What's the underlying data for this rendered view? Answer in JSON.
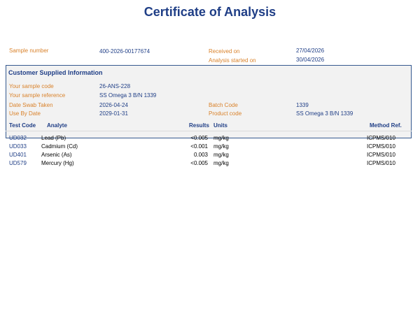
{
  "title": "Certificate of Analysis",
  "sample": {
    "sample_number_label": "Sample number",
    "sample_number": "400-2026-00177674",
    "received_on_label": "Received on",
    "received_on": "27/04/2026",
    "analysis_started_label": "Analysis started on",
    "analysis_started": "30/04/2026"
  },
  "customer": {
    "heading": "Customer Supplied Information",
    "sample_code_label": "Your sample code",
    "sample_code": "26-ANS-228",
    "sample_reference_label": "Your sample reference",
    "sample_reference": "SS Omega 3 B/N 1339",
    "date_swab_label": "Date Swab Taken",
    "date_swab": "2026-04-24",
    "batch_code_label": "Batch Code",
    "batch_code": "1339",
    "use_by_label": "Use By Date",
    "use_by": "2029-01-31",
    "product_code_label": "Product code",
    "product_code": "SS Omega 3 B/N 1339"
  },
  "results_table": {
    "headers": {
      "test_code": "Test Code",
      "analyte": "Analyte",
      "results": "Results",
      "units": "Units",
      "method_ref": "Method Ref."
    },
    "rows": [
      {
        "test_code": "UD032",
        "analyte": "Lead (Pb)",
        "result": "<0.005",
        "units": "mg/kg",
        "method": "ICPMS/010"
      },
      {
        "test_code": "UD033",
        "analyte": "Cadmium (Cd)",
        "result": "<0.001",
        "units": "mg/kg",
        "method": "ICPMS/010"
      },
      {
        "test_code": "UD401",
        "analyte": "Arsenic (As)",
        "result": "0.003",
        "units": "mg/kg",
        "method": "ICPMS/010"
      },
      {
        "test_code": "UD579",
        "analyte": "Mercury (Hg)",
        "result": "<0.005",
        "units": "mg/kg",
        "method": "ICPMS/010"
      }
    ]
  },
  "colors": {
    "title_blue": "#1f3e86",
    "label_orange": "#d9822b",
    "box_border": "#35598f",
    "box_fill": "#f2f2f2"
  }
}
